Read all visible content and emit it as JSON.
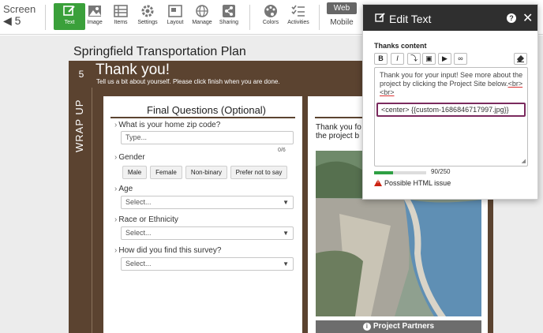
{
  "toolbar": {
    "screen_label": "Screen",
    "screen_number": "5",
    "items": [
      {
        "label": "Text",
        "icon": "edit-icon",
        "active": true
      },
      {
        "label": "Image",
        "icon": "image-icon"
      },
      {
        "label": "Items",
        "icon": "list-icon"
      },
      {
        "label": "Settings",
        "icon": "gear-icon"
      },
      {
        "label": "Layout",
        "icon": "layout-icon"
      },
      {
        "label": "Manage",
        "icon": "globe-icon"
      },
      {
        "label": "Sharing",
        "icon": "share-icon"
      },
      {
        "label": "Colors",
        "icon": "palette-icon"
      },
      {
        "label": "Activities",
        "icon": "checklist-icon"
      }
    ],
    "web_label": "Web",
    "mobile_label": "Mobile",
    "accent_color": "#3aa03a"
  },
  "survey": {
    "project_title": "Springfield Transportation Plan",
    "step_number": "5",
    "section_tab": "WRAP UP",
    "heading": "Thank you!",
    "subheading": "Tell us a bit about yourself. Please click finish when you are done.",
    "brown_color": "#5b4330",
    "final_questions": {
      "title": "Final Questions (Optional)",
      "zip_label": "What is your home zip code?",
      "zip_placeholder": "Type...",
      "zip_counter": "0/6",
      "gender_label": "Gender",
      "gender_options": [
        "Male",
        "Female",
        "Non-binary",
        "Prefer not to say"
      ],
      "age_label": "Age",
      "age_value": "Select...",
      "race_label": "Race or Ethnicity",
      "race_value": "Select...",
      "found_label": "How did you find this survey?",
      "found_value": "Select..."
    },
    "thanks_card": {
      "text_line1": "Thank you fo",
      "text_line2": "the project b",
      "partners_button": "Project Partners"
    }
  },
  "edit_panel": {
    "title": "Edit Text",
    "section_label": "Thanks content",
    "format_buttons": [
      {
        "label": "B",
        "icon": "bold-icon"
      },
      {
        "label": "I",
        "icon": "italic-icon"
      },
      {
        "label": "⤵",
        "icon": "insert-icon"
      },
      {
        "label": "▣",
        "icon": "image-icon"
      },
      {
        "label": "▶",
        "icon": "video-icon"
      },
      {
        "label": "∞",
        "icon": "link-icon"
      }
    ],
    "clear_format_icon": "eraser-icon",
    "content_text_before": "Thank you for your input! See more about the project by clicking the Project Site below.",
    "content_br1": "<br>",
    "content_br2": "<br>",
    "content_html_line": "<center> {{custom-1686846717997.jpg}}",
    "char_count": "90/250",
    "progress_fraction": 0.36,
    "warning_text": "Possible HTML issue",
    "highlight_color": "#7a2a5e"
  }
}
